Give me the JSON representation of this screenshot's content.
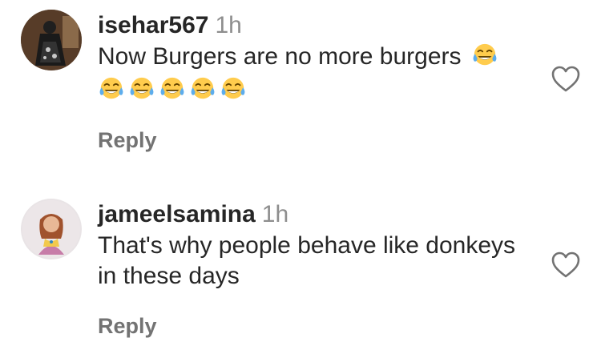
{
  "comments": [
    {
      "username": "isehar567",
      "time": "1h",
      "text": "Now Burgers are no more burgers",
      "emoji_count_inline": 1,
      "emoji_row_count": 5,
      "emoji": "face-with-tears-of-joy",
      "reply_label": "Reply"
    },
    {
      "username": "jameelsamina",
      "time": "1h",
      "text_line1": "That's why people behave like donkeys",
      "text_line2": "in these days",
      "reply_label": "Reply"
    }
  ],
  "icons": {
    "like": "heart-outline-icon",
    "emoji": "laughing-emoji-icon"
  },
  "colors": {
    "text": "#262626",
    "muted": "#8e8e8e",
    "reply": "#737373"
  }
}
